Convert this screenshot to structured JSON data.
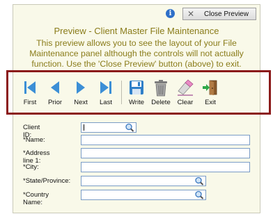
{
  "header": {
    "close_preview_label": "Close Preview",
    "close_icon": "close-x-icon",
    "info_icon": "info-icon"
  },
  "title": "Preview - Client Master File Maintenance",
  "message_lines": [
    "This preview allows you to see the layout of your File",
    "Maintenance panel although the controls will not actually",
    "function.  Use the 'Close Preview'  button (above) to exit."
  ],
  "toolbar": {
    "first": "First",
    "prior": "Prior",
    "next": "Next",
    "last": "Last",
    "write": "Write",
    "delete": "Delete",
    "clear": "Clear",
    "exit": "Exit"
  },
  "form": {
    "client_id": "Client ID:",
    "name": "*Name:",
    "address_line_1": "*Address line 1:",
    "city": "*City:",
    "state_province": "*State/Province:",
    "country_name": "*Country Name:"
  },
  "colors": {
    "message_text": "#8a7c1a",
    "highlight_border": "#8b1a1a",
    "nav_blue": "#3c8fd6",
    "background": "#f9f9e9"
  }
}
